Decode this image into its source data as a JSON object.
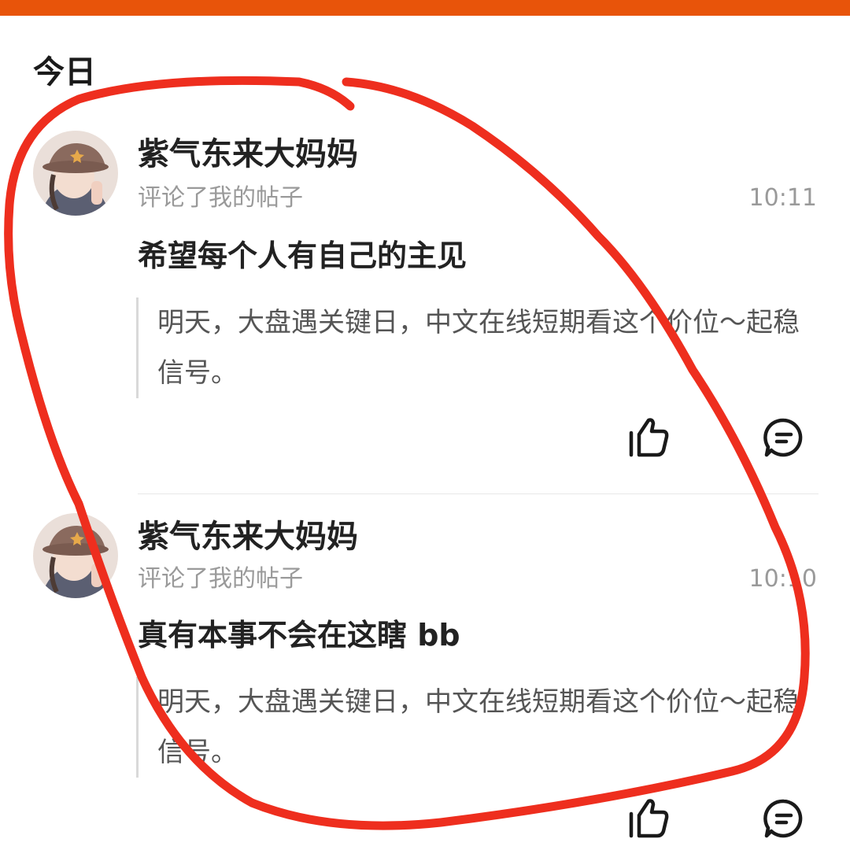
{
  "colors": {
    "accent_bar": "#E8540A",
    "annotation_stroke": "#EE2E1E"
  },
  "section": {
    "title": "今日"
  },
  "notifications": [
    {
      "avatar_icon": "avatar-girl-with-hat",
      "user_name": "紫气东来大妈妈",
      "action": "评论了我的帖子",
      "time": "10:11",
      "comment": "希望每个人有自己的主见",
      "quoted_post": "明天，大盘遇关键日，中文在线短期看这个价位～起稳信号。",
      "like_icon": "thumbs-up-icon",
      "reply_icon": "comment-bubble-icon"
    },
    {
      "avatar_icon": "avatar-girl-with-hat",
      "user_name": "紫气东来大妈妈",
      "action": "评论了我的帖子",
      "time": "10:10",
      "comment": "真有本事不会在这瞎  bb",
      "quoted_post": "明天，大盘遇关键日，中文在线短期看这个价位～起稳信号。",
      "like_icon": "thumbs-up-icon",
      "reply_icon": "comment-bubble-icon"
    }
  ]
}
